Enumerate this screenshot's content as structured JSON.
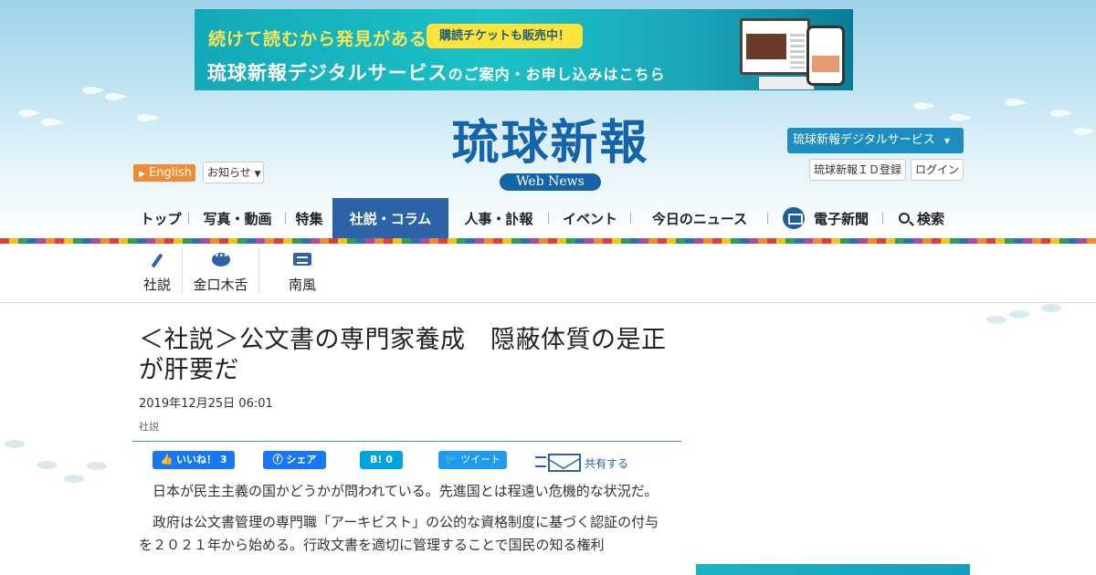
{
  "banner": {
    "line1": "続けて読むから発見がある",
    "pill": "購読チケットも販売中！",
    "line2_main": "琉球新報デジタルサービス",
    "line2_mid": "のご案内・お申し込み",
    "line2_end": "はこちら"
  },
  "logo": {
    "name": "琉球新報",
    "sub": "Web News"
  },
  "header": {
    "english": "English",
    "notice": "お知らせ",
    "digital": "琉球新報デジタルサービス",
    "id_register": "琉球新報ＩＤ登録",
    "login": "ログイン"
  },
  "nav": [
    {
      "label": "トップ"
    },
    {
      "label": "写真・動画"
    },
    {
      "label": "特集"
    },
    {
      "label": "社説・コラム"
    },
    {
      "label": "人事・訃報"
    },
    {
      "label": "イベント"
    },
    {
      "label": "今日のニュース"
    },
    {
      "label": "電子新聞"
    },
    {
      "label": "検索"
    }
  ],
  "subnav": [
    {
      "label": "社説",
      "icon": "pen-icon"
    },
    {
      "label": "金口木舌",
      "icon": "speech-bubble-icon"
    },
    {
      "label": "南風",
      "icon": "chat-icon"
    }
  ],
  "article": {
    "title": "＜社説＞公文書の専門家養成　隠蔽体質の是正が肝要だ",
    "date": "2019年12月25日 06:01",
    "category": "社説",
    "paragraphs": [
      "日本が民主主義の国かどうかが問われている。先進国とは程遠い危機的な状況だ。",
      "政府は公文書管理の専門職「アーキビスト」の公的な資格制度に基づく認証の付与を２０２１年から始める。行政文書を適切に管理することで国民の知る権利"
    ]
  },
  "share": {
    "like": "いいね！ 3",
    "facebook_share": "シェア",
    "hatena": "B! 0",
    "tweet": "ツイート",
    "mail_label": "共有する"
  },
  "colors": {
    "brand": "#1563a8",
    "nav_active": "#2b63a6",
    "english": "#ef8d35",
    "digital": "#1e8ec2"
  }
}
